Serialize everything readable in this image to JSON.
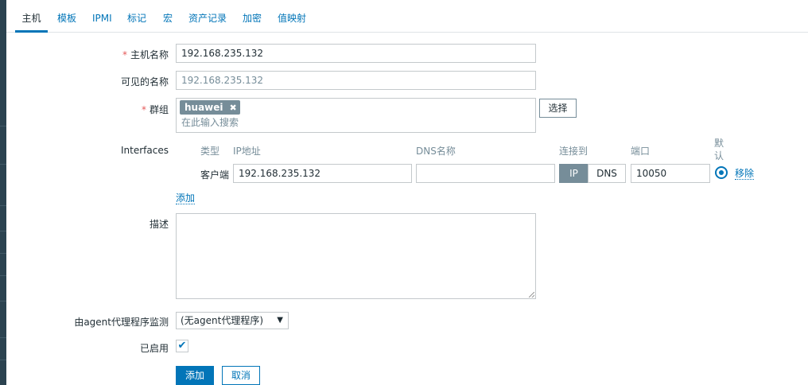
{
  "tabs": [
    {
      "label": "主机",
      "active": true
    },
    {
      "label": "模板"
    },
    {
      "label": "IPMI"
    },
    {
      "label": "标记"
    },
    {
      "label": "宏"
    },
    {
      "label": "资产记录"
    },
    {
      "label": "加密"
    },
    {
      "label": "值映射"
    }
  ],
  "form": {
    "required_mark": "*",
    "host_name": {
      "label": "主机名称",
      "value": "192.168.235.132"
    },
    "visible_name": {
      "label": "可见的名称",
      "placeholder": "192.168.235.132"
    },
    "groups": {
      "label": "群组",
      "tags": [
        "huawei"
      ],
      "tag_remove_icon": "close-icon",
      "placeholder": "在此输入搜索",
      "select_label": "选择"
    },
    "interfaces": {
      "label": "Interfaces",
      "headers": {
        "type": "类型",
        "ip": "IP地址",
        "dns": "DNS名称",
        "connect": "连接到",
        "port": "端口",
        "default": "默认"
      },
      "rows": [
        {
          "type": "客户端",
          "ip": "192.168.235.132",
          "dns": "",
          "connect_ip": "IP",
          "connect_dns": "DNS",
          "connect_selected": "IP",
          "port": "10050",
          "remove": "移除"
        }
      ],
      "add": "添加"
    },
    "description": {
      "label": "描述",
      "value": ""
    },
    "proxy": {
      "label": "由agent代理程序监测",
      "selected": "(无agent代理程序)",
      "caret_icon": "chevron-down-icon"
    },
    "enabled": {
      "label": "已启用",
      "checked": true,
      "check_mark": "✔"
    },
    "buttons": {
      "add": "添加",
      "cancel": "取消"
    }
  },
  "colors": {
    "accent": "#0275b8",
    "required": "#e45959",
    "muted": "#768d99"
  }
}
